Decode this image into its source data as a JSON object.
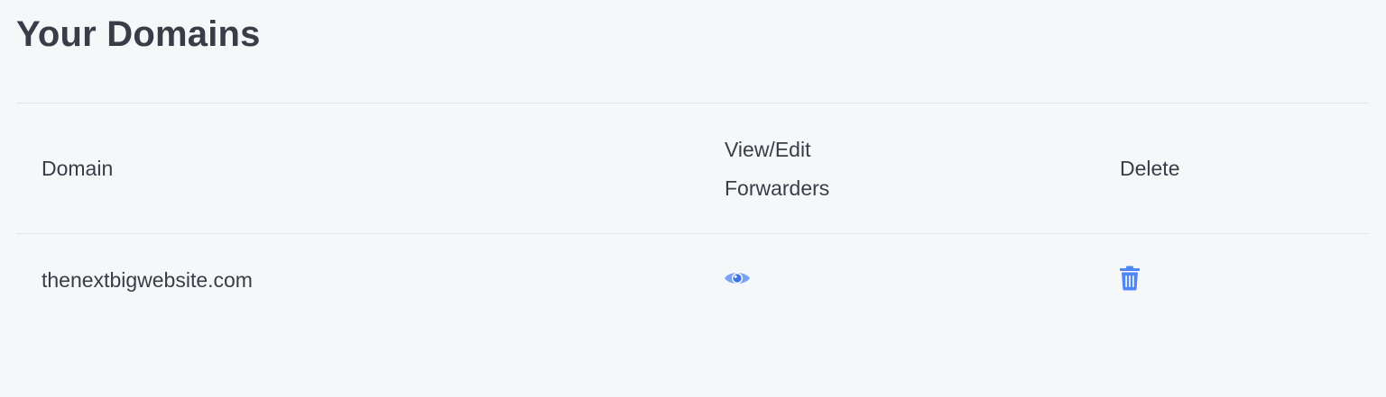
{
  "page": {
    "title": "Your Domains"
  },
  "table": {
    "headers": {
      "domain": "Domain",
      "view_edit_line1": "View/Edit",
      "view_edit_line2": "Forwarders",
      "delete": "Delete"
    },
    "rows": [
      {
        "domain": "thenextbigwebsite.com",
        "view_icon": "eye-icon",
        "delete_icon": "trash-icon"
      }
    ]
  },
  "colors": {
    "background": "#f6f7f9",
    "text": "#3a3c48",
    "divider": "#e1e3e7",
    "icon_accent": "#4f86f7",
    "icon_accent_light": "#7aa3f5"
  }
}
